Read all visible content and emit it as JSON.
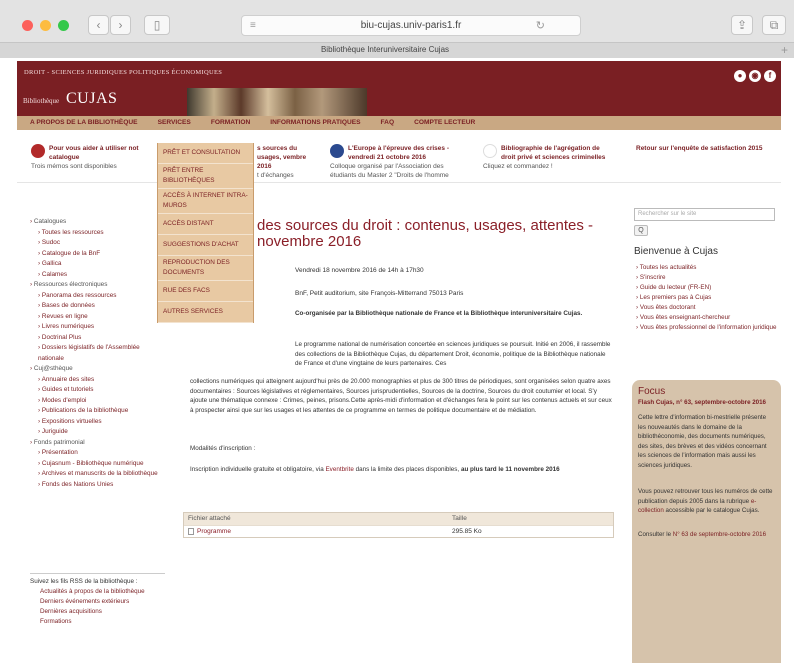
{
  "browser": {
    "address": "biu-cujas.univ-paris1.fr",
    "tab_title": "Bibliothèque Interuniversitaire Cujas",
    "back_glyph": "‹",
    "forward_glyph": "›",
    "sidebar_glyph": "▯",
    "address_menu_glyph": "≡",
    "reload_glyph": "↻",
    "share_glyph": "⇪",
    "tabs_glyph": "⧉",
    "new_tab_glyph": "+"
  },
  "header": {
    "top_text": "DROIT - SCIENCES JURIDIQUES POLITIQUES ÉCONOMIQUES",
    "logo_small": "Bibliothèque",
    "logo_big": "CUJAS",
    "social_icons": [
      "person-icon",
      "rss-icon",
      "facebook-icon"
    ],
    "social_glyphs": [
      "●",
      "◉",
      "f"
    ],
    "nav": [
      "A PROPOS DE LA BIBLIOTHÈQUE",
      "SERVICES",
      "FORMATION",
      "INFORMATIONS PRATIQUES",
      "FAQ",
      "COMPTE LECTEUR"
    ]
  },
  "news": [
    {
      "title": "Pour vous aider à utiliser not catalogue",
      "text": "Trois mémos sont disponibles"
    },
    {
      "title": "s sources du usages, vembre 2016",
      "text": "t d'échanges"
    },
    {
      "title": "L'Europe à l'épreuve des crises - vendredi 21 octobre 2016",
      "text": "Colloque organisé par l'Association des étudiants du Master 2 \"Droits de l'homme"
    },
    {
      "title": "Bibliographie de l'agrégation de droit privé et sciences criminelles",
      "text": "Cliquez et commandez !"
    },
    {
      "title": "Retour sur l'enquête de satisfaction 2015",
      "text": ""
    }
  ],
  "dropdown": [
    "PRÊT ET CONSULTATION",
    "PRÊT ENTRE BIBLIOTHÈQUES",
    "ACCÈS À INTERNET INTRA-MUROS",
    "ACCÈS DISTANT",
    "SUGGESTIONS D'ACHAT",
    "REPRODUCTION DES DOCUMENTS",
    "RUE DES FACS",
    "AUTRES SERVICES"
  ],
  "left_nav": [
    {
      "level": 1,
      "label": "Catalogues"
    },
    {
      "level": 2,
      "label": "Toutes les ressources"
    },
    {
      "level": 2,
      "label": "Sudoc"
    },
    {
      "level": 2,
      "label": "Catalogue de la BnF"
    },
    {
      "level": 2,
      "label": "Gallica"
    },
    {
      "level": 2,
      "label": "Calames"
    },
    {
      "level": 1,
      "label": "Ressources électroniques"
    },
    {
      "level": 2,
      "label": "Panorama des ressources"
    },
    {
      "level": 2,
      "label": "Bases de données"
    },
    {
      "level": 2,
      "label": "Revues en ligne"
    },
    {
      "level": 2,
      "label": "Livres numériques"
    },
    {
      "level": 2,
      "label": "Doctrinal Plus"
    },
    {
      "level": 2,
      "label": "Dossiers législatifs de l'Assemblée nationale"
    },
    {
      "level": 1,
      "label": "Cuj@sthèque"
    },
    {
      "level": 2,
      "label": "Annuaire des sites"
    },
    {
      "level": 2,
      "label": "Guides et tutoriels"
    },
    {
      "level": 2,
      "label": "Modes d'emploi"
    },
    {
      "level": 2,
      "label": "Publications de la bibliothèque"
    },
    {
      "level": 2,
      "label": "Expositions virtuelles"
    },
    {
      "level": 2,
      "label": "Juriguide"
    },
    {
      "level": 1,
      "label": "Fonds patrimonial"
    },
    {
      "level": 2,
      "label": "Présentation"
    },
    {
      "level": 2,
      "label": "Cujasnum - Bibliothèque numérique"
    },
    {
      "level": 2,
      "label": "Archives et manuscrits de la bibliothèque"
    },
    {
      "level": 2,
      "label": "Fonds des Nations Unies"
    }
  ],
  "rss": {
    "title": "Suivez les fils RSS de la bibliothèque :",
    "items": [
      "Actualités à propos de la bibliothèque",
      "Derniers événements extérieurs",
      "Dernières acquisitions",
      "Formations"
    ]
  },
  "article": {
    "title": "des sources du droit : contenus, usages, attentes - novembre 2016",
    "date": "Vendredi 18 novembre 2016 de 14h à 17h30",
    "place": "BnF, Petit auditorium, site François-Mitterrand 75013 Paris",
    "coorg": "Co-organisée par la Bibliothèque nationale de France et la Bibliothèque interuniversitaire Cujas.",
    "para_part1": "Le programme national de numérisation concertée en sciences juridiques se poursuit. Initié en 2006, il rassemble des collections de la Bibliothèque Cujas, du département Droit, économie, politique de la Bibliothèque nationale de France et d'une vingtaine de leurs partenaires. Ces",
    "para_part2": "collections numériques qui atteignent aujourd'hui près de 20.000 monographies et plus de 300 titres de périodiques, sont organisées selon quatre axes documentaires : Sources législatives et réglementaires, Sources jurisprudentielles, Sources de la doctrine, Sources du droit coutumier et local. S'y ajoute une thématique connexe : Crimes, peines, prisons.Cette après-midi d'information et d'échanges fera le point sur les contenus actuels et sur ceux à prospecter ainsi que sur les usages et les attentes de ce programme en termes de politique documentaire et de médiation.",
    "modalites": "Modalités d'inscription :",
    "inscription_before": "Inscription individuelle gratuite et obligatoire, via",
    "inscription_link": "Eventbrite",
    "inscription_after": "dans la limite des places disponibles,",
    "inscription_bold": "au plus tard le 11 novembre 2016",
    "table": {
      "col1": "Fichier attaché",
      "col2": "Taille",
      "file": "Programme",
      "size": "295.85 Ko"
    }
  },
  "right": {
    "search_placeholder": "Rechercher sur le site",
    "search_button": "Q",
    "welcome_title": "Bienvenue à Cujas",
    "welcome_links": [
      "Toutes les actualités",
      "S'inscrire",
      "Guide du lecteur (FR-EN)",
      "Les premiers pas à Cujas",
      "Vous êtes doctorant",
      "Vous êtes enseignant-chercheur",
      "Vous êtes professionnel de l'information juridique"
    ],
    "focus": {
      "title": "Focus",
      "subtitle": "Flash Cujas, n° 63, septembre-octobre 2016",
      "text1": "Cette lettre d'information bi-mestrielle présente les nouveautés dans le domaine de la bibliothéconomie, des documents numériques, des sites, des brèves et des vidéos concernant les sciences de l'information mais aussi les sciences juridiques.",
      "text2_before": "Vous pouvez retrouver tous les numéros de cette publication depuis 2005 dans la rubrique",
      "text2_link": "e-collection",
      "text2_after": "accessible par le catalogue Cujas.",
      "text3_before": "Consulter le",
      "text3_link": "N° 63 de septembre-octobre 2016"
    }
  }
}
